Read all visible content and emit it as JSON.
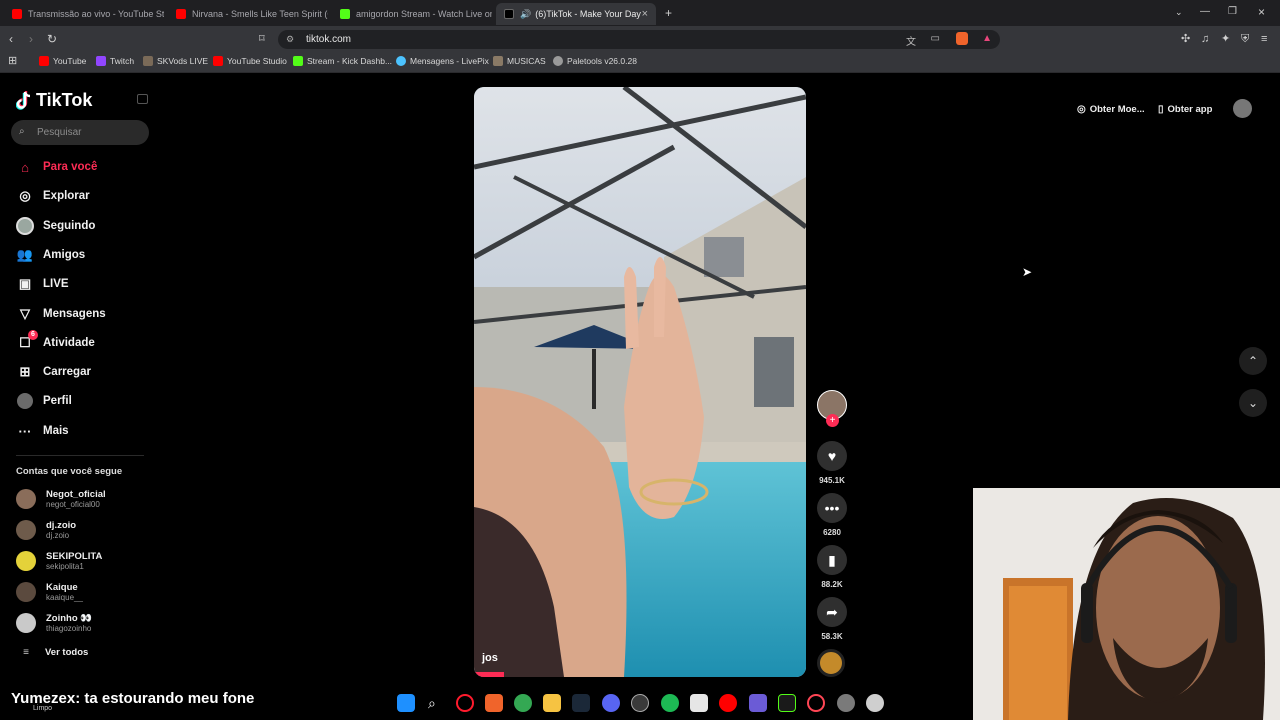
{
  "browser": {
    "tabs": [
      {
        "title": "Transmissão ao vivo - YouTube Studio",
        "color": "#ff0000"
      },
      {
        "title": "Nirvana - Smells Like Teen Spirit (Offi",
        "color": "#ff0000"
      },
      {
        "title": "amigordon Stream - Watch Live on K",
        "color": "#53fc18"
      },
      {
        "title": "(6)TikTok - Make Your Day",
        "color": "#ffffff",
        "active": true
      }
    ],
    "url": "tiktok.com",
    "bookmarks": [
      {
        "label": "YouTube",
        "color": "#ff0000"
      },
      {
        "label": "Twitch",
        "color": "#9146ff"
      },
      {
        "label": "SKVods LIVE",
        "color": "#7a6a58"
      },
      {
        "label": "YouTube Studio",
        "color": "#ff0000"
      },
      {
        "label": "Stream - Kick Dashb...",
        "color": "#53fc18"
      },
      {
        "label": "Mensagens - LivePix",
        "color": "#4cc3ff"
      },
      {
        "label": "MUSICAS",
        "color": "#8a7a66"
      },
      {
        "label": "Paletools v26.0.28",
        "color": "#9a9a9a"
      }
    ]
  },
  "tiktok": {
    "logo": "TikTok",
    "search_placeholder": "Pesquisar",
    "nav": [
      {
        "label": "Para você",
        "icon": "home-icon",
        "active": true
      },
      {
        "label": "Explorar",
        "icon": "compass-icon"
      },
      {
        "label": "Seguindo",
        "icon": "following-avatar-icon"
      },
      {
        "label": "Amigos",
        "icon": "friends-icon"
      },
      {
        "label": "LIVE",
        "icon": "live-icon"
      },
      {
        "label": "Mensagens",
        "icon": "messages-icon"
      },
      {
        "label": "Atividade",
        "icon": "activity-icon",
        "badge": "6"
      },
      {
        "label": "Carregar",
        "icon": "upload-icon"
      },
      {
        "label": "Perfil",
        "icon": "profile-icon"
      },
      {
        "label": "Mais",
        "icon": "more-icon"
      }
    ],
    "following_header": "Contas que você segue",
    "following": [
      {
        "name": "Negot_oficial",
        "handle": "negot_oficial00",
        "color": "#8a6d5a"
      },
      {
        "name": "dj.zoio",
        "handle": "dj.zoio",
        "color": "#6e5b4b"
      },
      {
        "name": "SEKIPOLITA",
        "handle": "sekipolita1",
        "color": "#e4d23a"
      },
      {
        "name": "Kaique",
        "handle": "kaaique__",
        "color": "#5b4a3e"
      },
      {
        "name": "Zoinho 👀",
        "handle": "thiagozoinho",
        "color": "#c9c9c9"
      }
    ],
    "see_all": "Ver todos",
    "top_right": {
      "coins": "Obter Moe...",
      "app": "Obter app"
    },
    "video": {
      "author": "jos",
      "likes": "945.1K",
      "comments": "6280",
      "saves": "88.2K",
      "shares": "58.3K"
    }
  },
  "overlay": {
    "chat_line": "Yumezex: ta estourando meu fone",
    "chat_sub": "Limpo"
  },
  "colors": {
    "accent": "#fe2c55",
    "bg": "#000000",
    "sidebar_text": "#f1f1f1"
  }
}
